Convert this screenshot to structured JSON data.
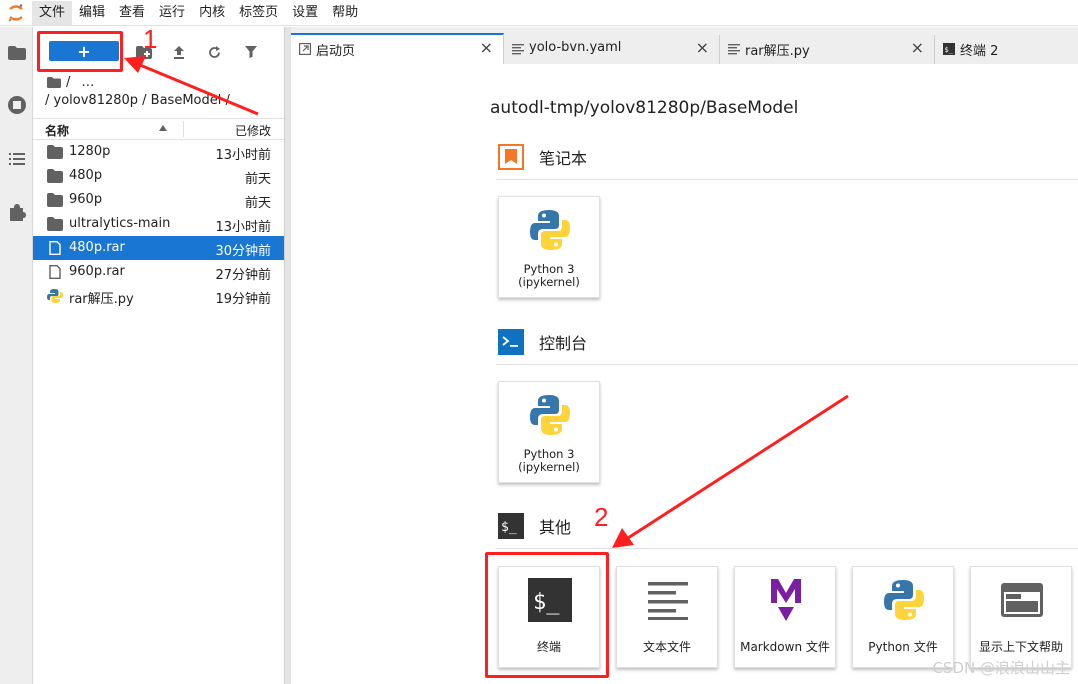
{
  "menu": {
    "items": [
      "文件",
      "编辑",
      "查看",
      "运行",
      "内核",
      "标签页",
      "设置",
      "帮助"
    ],
    "active_index": 0
  },
  "filebrowser": {
    "new_label": "+",
    "breadcrumb_root": "/",
    "breadcrumb_more": "…",
    "current_path": "/ yolov81280p / BaseModel /",
    "header": {
      "name": "名称",
      "modified": "已修改"
    },
    "rows": [
      {
        "name": "1280p",
        "modified": "13小时前",
        "type": "folder"
      },
      {
        "name": "480p",
        "modified": "前天",
        "type": "folder"
      },
      {
        "name": "960p",
        "modified": "前天",
        "type": "folder"
      },
      {
        "name": "ultralytics-main",
        "modified": "13小时前",
        "type": "folder"
      },
      {
        "name": "480p.rar",
        "modified": "30分钟前",
        "type": "file",
        "selected": true
      },
      {
        "name": "960p.rar",
        "modified": "27分钟前",
        "type": "file"
      },
      {
        "name": "rar解压.py",
        "modified": "19分钟前",
        "type": "python"
      }
    ]
  },
  "tabs": [
    {
      "label": "启动页",
      "icon": "launcher-icon",
      "active": true
    },
    {
      "label": "yolo-bvn.yaml",
      "icon": "text-file-icon"
    },
    {
      "label": "rar解压.py",
      "icon": "text-file-icon"
    },
    {
      "label": "终端 2",
      "icon": "terminal-icon"
    }
  ],
  "launcher": {
    "path": "autodl-tmp/yolov81280p/BaseModel",
    "sections": {
      "notebook": {
        "title": "笔记本",
        "cards": [
          {
            "line1": "Python 3",
            "line2": "(ipykernel)"
          }
        ]
      },
      "console": {
        "title": "控制台",
        "cards": [
          {
            "line1": "Python 3",
            "line2": "(ipykernel)"
          }
        ]
      },
      "other": {
        "title": "其他",
        "cards": [
          {
            "label": "终端",
            "icon": "terminal-icon"
          },
          {
            "label": "文本文件",
            "icon": "text-lines-icon"
          },
          {
            "label": "Markdown 文件",
            "icon": "markdown-icon"
          },
          {
            "label": "Python 文件",
            "icon": "python-icon"
          },
          {
            "label": "显示上下文帮助",
            "icon": "context-help-icon"
          }
        ]
      }
    }
  },
  "annotations": {
    "num1": "1",
    "num2": "2",
    "color": "#ff1f1f"
  },
  "watermark": "CSDN @浪浪山山主",
  "colors": {
    "accent": "#1976d2",
    "notebook_orange": "#f37726",
    "console_blue": "#0e72c1",
    "terminal_dark": "#333333",
    "markdown_purple": "#7b1fa2"
  }
}
